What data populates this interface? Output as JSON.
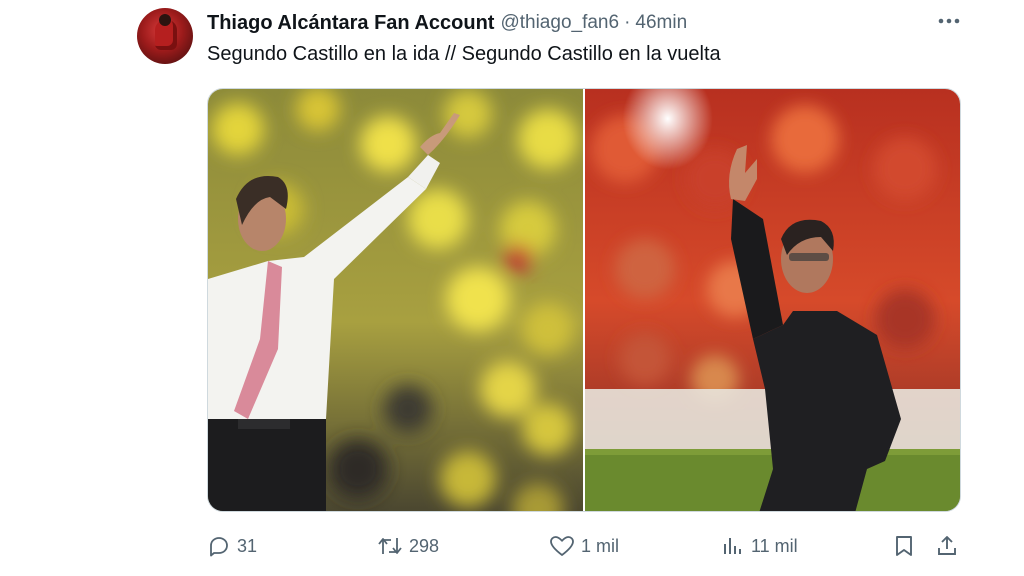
{
  "author": {
    "display_name": "Thiago Alcántara Fan Account",
    "handle": "@thiago_fan6",
    "separator": "·",
    "time_ago": "46min"
  },
  "tweet": {
    "text": "Segundo Castillo en la ida // Segundo Castillo en la vuelta"
  },
  "media": {
    "count": 2,
    "left_image": "coach-yellow-stadium-pointing",
    "right_image": "coach-red-stadium-waving"
  },
  "actions": {
    "replies": "31",
    "reposts": "298",
    "likes": "1 mil",
    "views": "11 mil"
  },
  "icons": {
    "more": "more-options-icon",
    "reply": "reply-icon",
    "repost": "repost-icon",
    "like": "heart-icon",
    "views": "views-icon",
    "bookmark": "bookmark-icon",
    "share": "share-icon"
  },
  "colors": {
    "text_primary": "#0f1419",
    "text_secondary": "#536471",
    "border": "#cfd9de"
  }
}
